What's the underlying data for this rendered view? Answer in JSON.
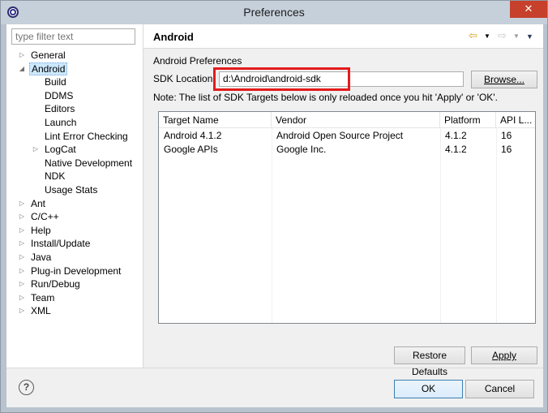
{
  "window": {
    "title": "Preferences",
    "close_glyph": "✕"
  },
  "sidebar": {
    "filter_placeholder": "type filter text",
    "items": [
      {
        "label": "General",
        "expander": "collapsed"
      },
      {
        "label": "Android",
        "expander": "expanded",
        "selected": true
      },
      {
        "label": "Build"
      },
      {
        "label": "DDMS"
      },
      {
        "label": "Editors"
      },
      {
        "label": "Launch"
      },
      {
        "label": "Lint Error Checking"
      },
      {
        "label": "LogCat",
        "expander": "collapsed"
      },
      {
        "label": "Native Development"
      },
      {
        "label": "NDK"
      },
      {
        "label": "Usage Stats"
      },
      {
        "label": "Ant",
        "expander": "collapsed"
      },
      {
        "label": "C/C++",
        "expander": "collapsed"
      },
      {
        "label": "Help",
        "expander": "collapsed"
      },
      {
        "label": "Install/Update",
        "expander": "collapsed"
      },
      {
        "label": "Java",
        "expander": "collapsed"
      },
      {
        "label": "Plug-in Development",
        "expander": "collapsed"
      },
      {
        "label": "Run/Debug",
        "expander": "collapsed"
      },
      {
        "label": "Team",
        "expander": "collapsed"
      },
      {
        "label": "XML",
        "expander": "collapsed"
      }
    ]
  },
  "page": {
    "title": "Android",
    "section_label": "Android Preferences",
    "sdk_label": "SDK Location:",
    "sdk_value": "d:\\Android\\android-sdk",
    "browse_button": "Browse...",
    "note": "Note: The list of SDK Targets below is only reloaded once you hit 'Apply' or 'OK'.",
    "table": {
      "columns": [
        "Target Name",
        "Vendor",
        "Platform",
        "API L..."
      ],
      "rows": [
        [
          "Android 4.1.2",
          "Android Open Source Project",
          "4.1.2",
          "16"
        ],
        [
          "Google APIs",
          "Google Inc.",
          "4.1.2",
          "16"
        ]
      ]
    },
    "restore_defaults_button": "Restore Defaults",
    "apply_button": "Apply"
  },
  "footer": {
    "help_glyph": "?",
    "ok_button": "OK",
    "cancel_button": "Cancel"
  },
  "colors": {
    "highlight": "#e31b1b",
    "close_button": "#c7402b",
    "selection": "#cce8ff"
  }
}
